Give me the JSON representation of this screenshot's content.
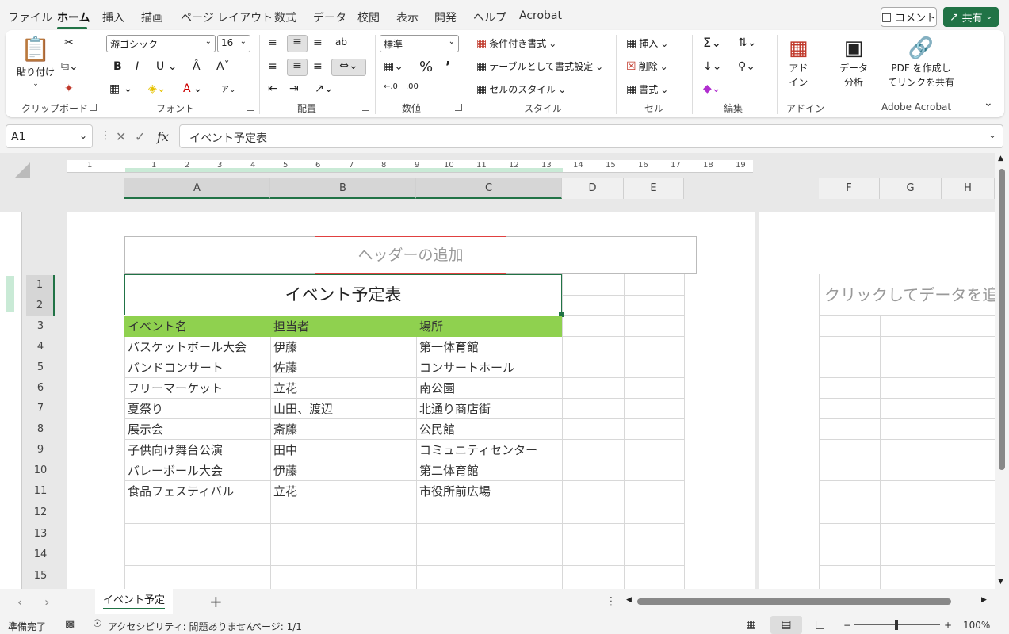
{
  "menu": {
    "tabs": [
      "ファイル",
      "ホーム",
      "挿入",
      "描画",
      "ページ レイアウト",
      "数式",
      "データ",
      "校閲",
      "表示",
      "開発",
      "ヘルプ",
      "Acrobat"
    ],
    "active": "ホーム",
    "comment": "コメント",
    "share": "共有"
  },
  "ribbon": {
    "clipboard": {
      "paste": "貼り付け",
      "label": "クリップボード"
    },
    "font": {
      "name": "游ゴシック",
      "size": "16",
      "label": "フォント"
    },
    "alignment": {
      "label": "配置"
    },
    "number": {
      "format": "標準",
      "label": "数値"
    },
    "styles": {
      "conditional": "条件付き書式",
      "table": "テーブルとして書式設定",
      "cellstyle": "セルのスタイル",
      "label": "スタイル"
    },
    "cells": {
      "insert": "挿入",
      "delete": "削除",
      "format": "書式",
      "label": "セル"
    },
    "editing": {
      "label": "編集"
    },
    "addins": {
      "btn1": "アド",
      "btn2": "イン",
      "label": "アドイン"
    },
    "analysis": {
      "btn1": "データ",
      "btn2": "分析"
    },
    "acrobat": {
      "btn1": "PDF を作成し",
      "btn2": "てリンクを共有",
      "label": "Adobe Acrobat"
    }
  },
  "formulabar": {
    "cellref": "A1",
    "content": "イベント予定表"
  },
  "sheet": {
    "columns": [
      "A",
      "B",
      "C",
      "D",
      "E",
      "F",
      "G",
      "H"
    ],
    "rows": [
      "1",
      "2",
      "3",
      "4",
      "5",
      "6",
      "7",
      "8",
      "9",
      "10",
      "11",
      "12",
      "13",
      "14",
      "15"
    ],
    "ruler": [
      "1",
      "1",
      "2",
      "3",
      "4",
      "5",
      "6",
      "7",
      "8",
      "9",
      "10",
      "11",
      "12",
      "13",
      "14",
      "15",
      "16",
      "17",
      "18",
      "19"
    ],
    "header_placeholder": "ヘッダーの追加",
    "add_data": "クリックしてデータを追加",
    "title": "イベント予定表",
    "table_headers": [
      "イベント名",
      "担当者",
      "場所"
    ],
    "table_rows": [
      [
        "バスケットボール大会",
        "伊藤",
        "第一体育館"
      ],
      [
        "バンドコンサート",
        "佐藤",
        "コンサートホール"
      ],
      [
        "フリーマーケット",
        "立花",
        "南公園"
      ],
      [
        "夏祭り",
        "山田、渡辺",
        "北通り商店街"
      ],
      [
        "展示会",
        "斎藤",
        "公民館"
      ],
      [
        "子供向け舞台公演",
        "田中",
        "コミュニティセンター"
      ],
      [
        "バレーボール大会",
        "伊藤",
        "第二体育館"
      ],
      [
        "食品フェスティバル",
        "立花",
        "市役所前広場"
      ]
    ],
    "header_color": "#8fd14f"
  },
  "tabs": {
    "sheet_name": "イベント予定"
  },
  "status": {
    "ready": "準備完了",
    "accessibility": "アクセシビリティ: 問題ありません",
    "page": "ページ: 1/1",
    "zoom": "100%"
  }
}
